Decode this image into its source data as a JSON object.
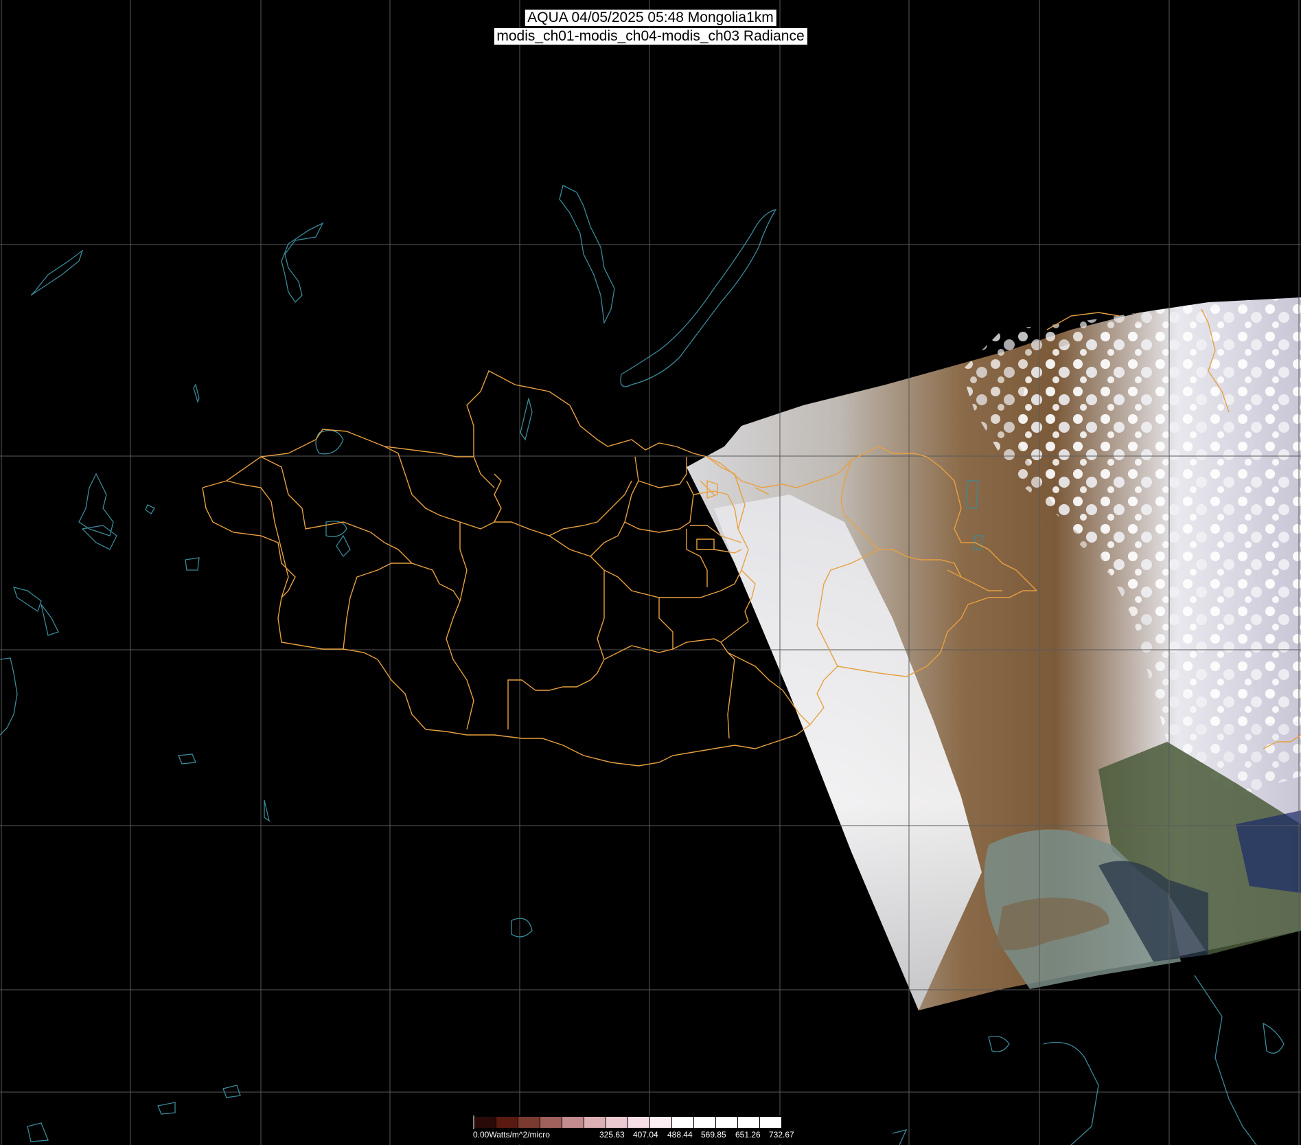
{
  "header": {
    "line1": "AQUA 04/05/2025 05:48 Mongolia1km",
    "line2": "modis_ch01-modis_ch04-modis_ch03 Radiance"
  },
  "legend": {
    "unit_label": "0.00Watts/m^2/micro",
    "ticks": [
      "325.63",
      "407.04",
      "488.44",
      "569.85",
      "651.26",
      "732.67"
    ],
    "colors": [
      "#2a0a08",
      "#5a1a12",
      "#7a3a30",
      "#a0605c",
      "#c48c8e",
      "#dcb0b4",
      "#eccad2",
      "#f5dee6",
      "#faeef2",
      "#ffffff",
      "#ffffff",
      "#ffffff",
      "#ffffff",
      "#ffffff"
    ]
  },
  "map": {
    "background": "#000000",
    "grid_color": "#5a5a5a",
    "border_color": "#e8a040",
    "coast_color": "#3a8a9a"
  }
}
